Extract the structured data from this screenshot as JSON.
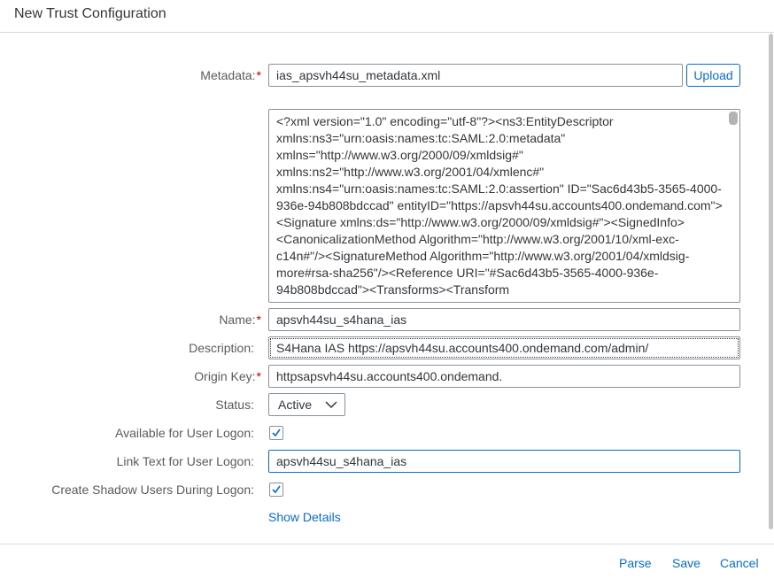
{
  "dialog": {
    "title": "New Trust Configuration"
  },
  "form": {
    "metadata": {
      "label": "Metadata:",
      "required_marker": "*",
      "value": "ias_apsvh44su_metadata.xml",
      "upload_label": "Upload"
    },
    "metadata_xml": {
      "lines": [
        "<?xml version=\"1.0\" encoding=\"utf-8\"?><ns3:EntityDescriptor",
        "xmlns:ns3=\"urn:oasis:names:tc:SAML:2.0:metadata\"",
        "xmlns=\"http://www.w3.org/2000/09/xmldsig#\"",
        "xmlns:ns2=\"http://www.w3.org/2001/04/xmlenc#\"",
        "xmlns:ns4=\"urn:oasis:names:tc:SAML:2.0:assertion\" ID=\"Sac6d43b5-3565-4000-",
        "936e-94b808bdccad\" entityID=\"https://apsvh44su.accounts400.ondemand.com\">",
        "<Signature xmlns:ds=\"http://www.w3.org/2000/09/xmldsig#\"><SignedInfo>",
        "<CanonicalizationMethod Algorithm=\"http://www.w3.org/2001/10/xml-exc-",
        "c14n#\"/><SignatureMethod Algorithm=\"http://www.w3.org/2001/04/xmldsig-",
        "more#rsa-sha256\"/><Reference URI=\"#Sac6d43b5-3565-4000-936e-",
        "94b808bdccad\"><Transforms><Transform"
      ]
    },
    "name": {
      "label": "Name:",
      "required_marker": "*",
      "value": "apsvh44su_s4hana_ias"
    },
    "description": {
      "label": "Description:",
      "value": "S4Hana IAS https://apsvh44su.accounts400.ondemand.com/admin/"
    },
    "origin_key": {
      "label": "Origin Key:",
      "required_marker": "*",
      "value": "httpsapsvh44su.accounts400.ondemand."
    },
    "status": {
      "label": "Status:",
      "value": "Active"
    },
    "available_for_user_logon": {
      "label": "Available for User Logon:",
      "checked": true
    },
    "link_text": {
      "label": "Link Text for User Logon:",
      "value": "apsvh44su_s4hana_ias"
    },
    "create_shadow_users": {
      "label": "Create Shadow Users During Logon:",
      "checked": true
    },
    "show_details_label": "Show Details"
  },
  "footer": {
    "parse_label": "Parse",
    "save_label": "Save",
    "cancel_label": "Cancel"
  },
  "colors": {
    "accent": "#0a6ed1",
    "required": "#bb0000",
    "label_text": "#5b5b5b",
    "border": "#89919a"
  }
}
